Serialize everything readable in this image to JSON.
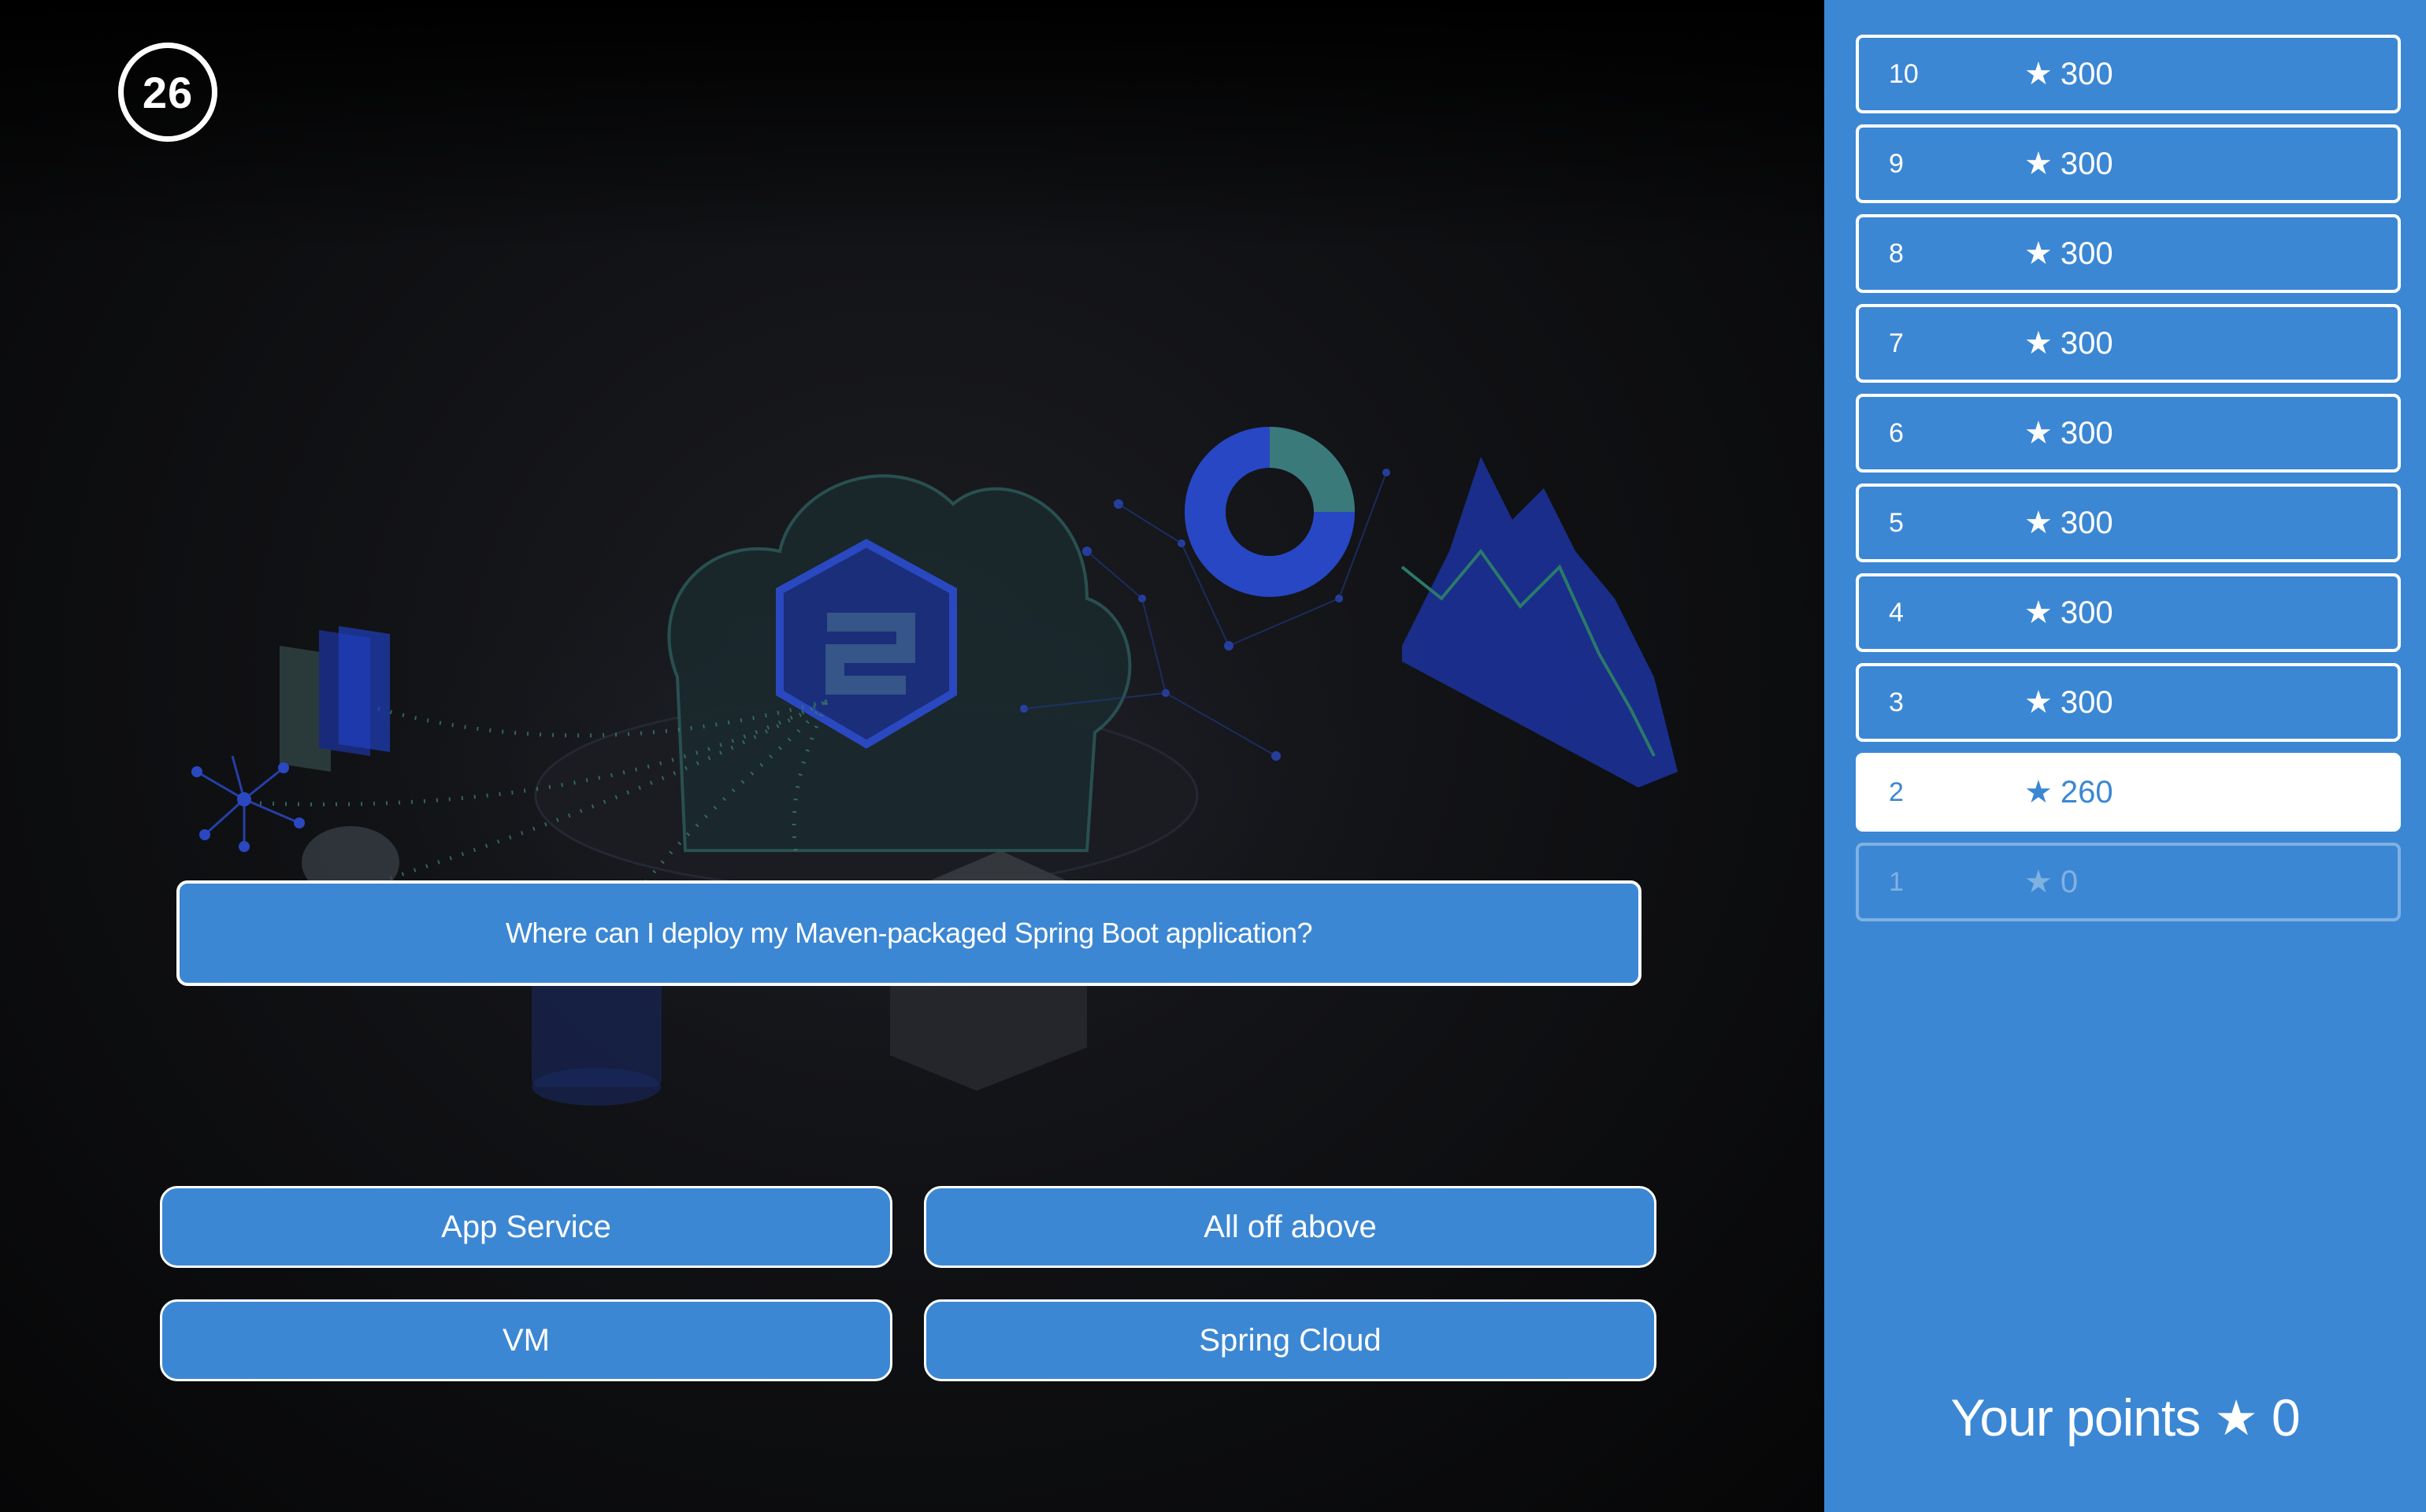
{
  "timer": {
    "seconds": "26"
  },
  "question": {
    "text": "Where can I deploy my Maven-packaged Spring Boot application?"
  },
  "answers": [
    {
      "label": "App Service"
    },
    {
      "label": "All off above"
    },
    {
      "label": "VM"
    },
    {
      "label": "Spring Cloud"
    }
  ],
  "ladder": {
    "star_icon": "star-icon",
    "rungs": [
      {
        "level": "10",
        "points": "300",
        "state": "default"
      },
      {
        "level": "9",
        "points": "300",
        "state": "default"
      },
      {
        "level": "8",
        "points": "300",
        "state": "default"
      },
      {
        "level": "7",
        "points": "300",
        "state": "default"
      },
      {
        "level": "6",
        "points": "300",
        "state": "default"
      },
      {
        "level": "5",
        "points": "300",
        "state": "default"
      },
      {
        "level": "4",
        "points": "300",
        "state": "default"
      },
      {
        "level": "3",
        "points": "300",
        "state": "default"
      },
      {
        "level": "2",
        "points": "260",
        "state": "current"
      },
      {
        "level": "1",
        "points": "0",
        "state": "locked"
      }
    ]
  },
  "score": {
    "label": "Your points",
    "value": "0"
  },
  "colors": {
    "accent": "#3c87d3",
    "panel": "#3b87d4",
    "background": "#111215",
    "text": "#ffffff"
  }
}
